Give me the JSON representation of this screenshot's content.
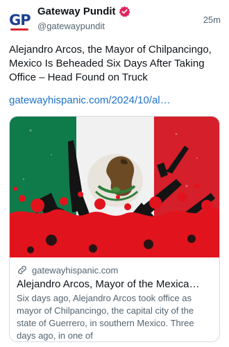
{
  "account": {
    "name": "Gateway Pundit",
    "handle": "@gatewaypundit",
    "logo_text": "GP",
    "time": "25m"
  },
  "tweet": {
    "text": "Alejandro Arcos, the Mayor of Chilpancingo, Mexico Is Beheaded Six Days After Taking Office – Head Found on Truck",
    "link": "gatewayhispanic.com/2024/10/al…"
  },
  "card": {
    "domain": "gatewayhispanic.com",
    "title": "Alejandro Arcos, Mayor of the Mexica…",
    "description": "Six days ago, Alejandro Arcos took office as mayor of Chilpancingo, the capital city of the state of Guerrero, in southern Mexico. Three days ago, in one of"
  },
  "colors": {
    "flag_green": "#0f7a4a",
    "flag_white": "#f2f2f2",
    "flag_red": "#d51f2a",
    "blood_red": "#e1131d",
    "link_blue": "#1d72c9",
    "verified_red": "#e0245e"
  }
}
